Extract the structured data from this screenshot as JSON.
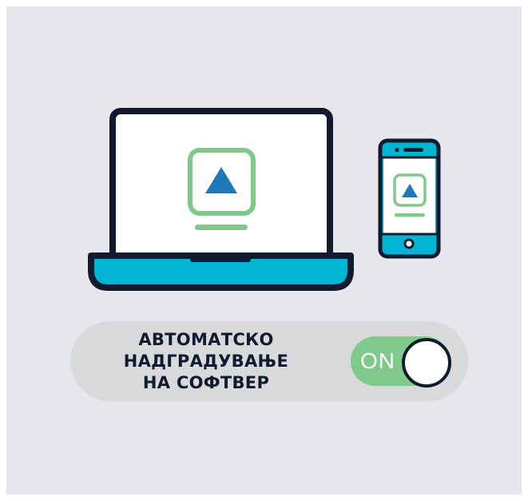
{
  "title": {
    "lines": [
      "АВТОМАТСКО",
      "НАДГРАДУВАЊЕ",
      "НА СОФТВЕР"
    ]
  },
  "toggle": {
    "state_label": "ON",
    "is_on": true
  },
  "icons": {
    "laptop": "laptop-icon",
    "phone": "smartphone-icon",
    "update": "upload-arrow-icon"
  },
  "colors": {
    "background": "#e6e6ec",
    "outline": "#111b2d",
    "accent_cyan": "#00b4d3",
    "accent_green": "#7fc98a",
    "arrow_blue": "#1f79b8",
    "toggle_bar": "#d7d9db"
  }
}
